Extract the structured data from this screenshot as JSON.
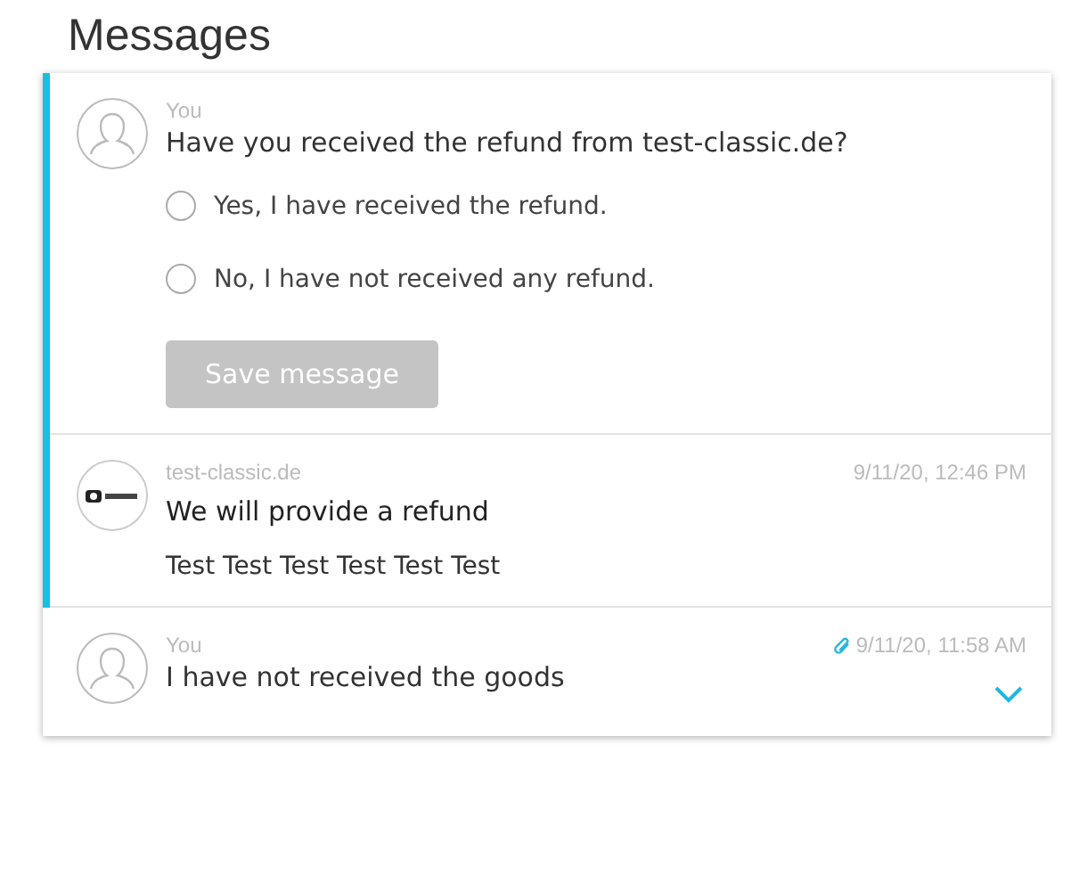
{
  "title": "Messages",
  "messages": [
    {
      "kind": "question",
      "avatar": {
        "kind": "user"
      },
      "highlighted": true,
      "sender": "You",
      "text": "Have you received the refund from test-classic.de?",
      "options": [
        {
          "label": "Yes, I have received the refund.",
          "selected": false
        },
        {
          "label": "No, I have not received any refund.",
          "selected": false
        }
      ],
      "button": {
        "label": "Save message",
        "disabled": true
      }
    },
    {
      "kind": "message",
      "avatar": {
        "kind": "logo"
      },
      "highlighted": true,
      "sender": "test-classic.de",
      "time": "9/11/20, 12:46 PM",
      "subject": "We will provide a refund",
      "body": "Test Test Test Test Test Test"
    },
    {
      "kind": "message",
      "avatar": {
        "kind": "user"
      },
      "highlighted": false,
      "sender": "You",
      "time": "9/11/20, 11:58 AM",
      "attachment": true,
      "expanded": false,
      "text": "I have not received the goods"
    }
  ]
}
